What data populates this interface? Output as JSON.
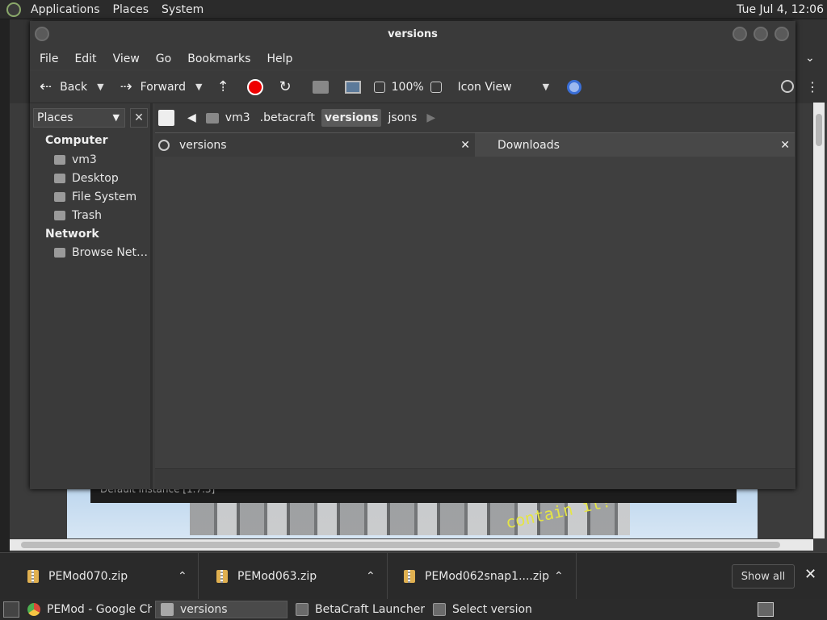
{
  "top_panel": {
    "menus": [
      "Applications",
      "Places",
      "System"
    ],
    "clock": "Tue Jul  4, 12:06"
  },
  "window": {
    "title": "versions",
    "menu": [
      "File",
      "Edit",
      "View",
      "Go",
      "Bookmarks",
      "Help"
    ]
  },
  "toolbar": {
    "back": "Back",
    "forward": "Forward",
    "zoom": "100%",
    "view_mode": "Icon View"
  },
  "sidepane": {
    "selector": "Places",
    "sections": [
      {
        "heading": "Computer",
        "items": [
          "vm3",
          "Desktop",
          "File System",
          "Trash"
        ]
      },
      {
        "heading": "Network",
        "items": [
          "Browse Net…"
        ]
      }
    ]
  },
  "pathbar": {
    "crumbs": [
      "vm3",
      ".betacraft",
      "versions",
      "jsons"
    ],
    "current": "versions"
  },
  "panes": {
    "left_title": "versions",
    "right_title": "Downloads"
  },
  "background_app": {
    "instance_bar": "Default instance [1.7.3]",
    "splash": "contain it!"
  },
  "downloads": {
    "items": [
      "PEMod070.zip",
      "PEMod063.zip",
      "PEMod062snap1....zip"
    ],
    "show_all": "Show all"
  },
  "taskbar": {
    "tasks": [
      "PEMod - Google Ch…",
      "versions",
      "BetaCraft Launcher …",
      "Select version"
    ]
  }
}
